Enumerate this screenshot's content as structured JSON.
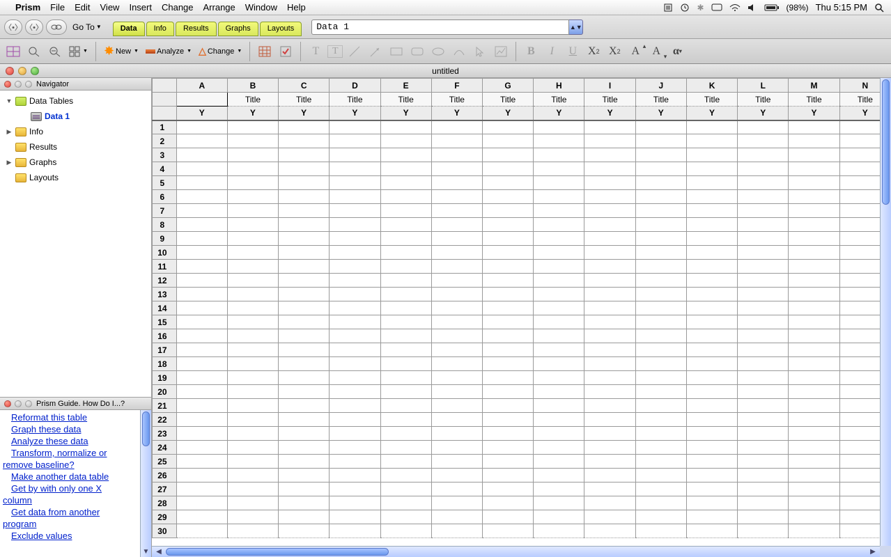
{
  "menubar": {
    "app": "Prism",
    "items": [
      "File",
      "Edit",
      "View",
      "Insert",
      "Change",
      "Arrange",
      "Window",
      "Help"
    ],
    "battery_text": "(98%)",
    "clock": "Thu 5:15 PM"
  },
  "toolbar1": {
    "goto": "Go To",
    "tabs": [
      "Data",
      "Info",
      "Results",
      "Graphs",
      "Layouts"
    ],
    "active_tab": 0,
    "sheetname": "Data 1"
  },
  "toolbar2": {
    "new": "New",
    "analyze": "Analyze",
    "change": "Change"
  },
  "window": {
    "title": "untitled"
  },
  "navigator": {
    "title": "Navigator",
    "sections": [
      {
        "label": "Data Tables",
        "open": true,
        "children": [
          {
            "label": "Data 1",
            "selected": true
          }
        ]
      },
      {
        "label": "Info",
        "open": false
      },
      {
        "label": "Results",
        "open": false
      },
      {
        "label": "Graphs",
        "open": false
      },
      {
        "label": "Layouts",
        "open": false
      }
    ]
  },
  "guide": {
    "title": "Prism Guide. How Do I...?",
    "links": [
      "Reformat this table",
      "Graph these data",
      "Analyze these data",
      "Transform, normalize or remove baseline?",
      "Make another data table",
      "Get by with only one X column",
      "Get data from another program",
      "Exclude values"
    ]
  },
  "sheet": {
    "columns": [
      "A",
      "B",
      "C",
      "D",
      "E",
      "F",
      "G",
      "H",
      "I",
      "J",
      "K",
      "L",
      "M",
      "N"
    ],
    "subheader": "Title",
    "yrow": "Y",
    "rows": 30
  }
}
